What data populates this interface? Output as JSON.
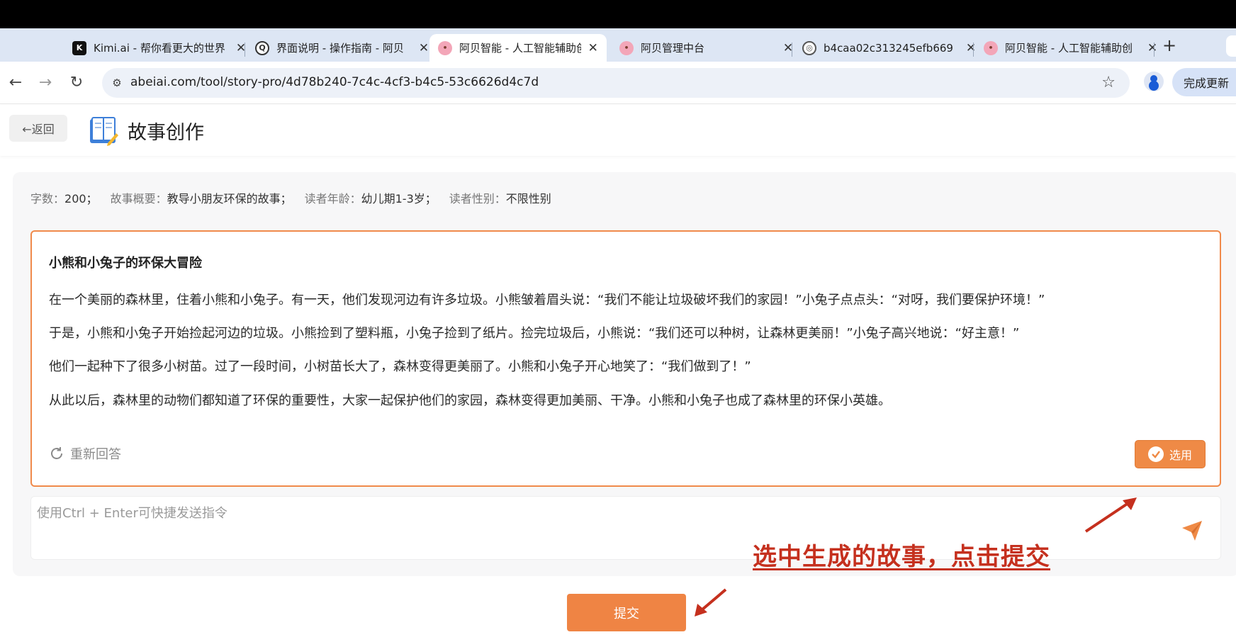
{
  "browser": {
    "tabs": [
      {
        "title": "Kimi.ai - 帮你看更大的世界",
        "icon": "kimi-logo-icon",
        "active": false
      },
      {
        "title": "界面说明 - 操作指南 - 阿贝",
        "icon": "document-icon",
        "active": false
      },
      {
        "title": "阿贝智能 - 人工智能辅助创",
        "icon": "abei-logo-icon",
        "active": true
      },
      {
        "title": "阿贝管理中台",
        "icon": "abei-logo-icon",
        "active": false
      },
      {
        "title": "b4caa02c313245efb669",
        "icon": "globe-icon",
        "active": false
      },
      {
        "title": "阿贝智能 - 人工智能辅助创",
        "icon": "abei-logo-icon",
        "active": false
      }
    ],
    "new_tab_label": "+",
    "url": "abeiai.com/tool/story-pro/4d78b240-7c4c-4cf3-b4c5-53c6626d4c7d",
    "update_label": "完成更新",
    "accent": "#dde6f4"
  },
  "header": {
    "back_label": "←返回",
    "title": "故事创作"
  },
  "meta": {
    "word_count_label": "字数：",
    "word_count_value": "200；",
    "summary_label": "故事概要：",
    "summary_value": "教导小朋友环保的故事；",
    "age_label": "读者年龄：",
    "age_value": "幼儿期1-3岁；",
    "gender_label": "读者性别：",
    "gender_value": "不限性别"
  },
  "story": {
    "title": "小熊和小兔子的环保大冒险",
    "paragraphs": [
      "在一个美丽的森林里，住着小熊和小兔子。有一天，他们发现河边有许多垃圾。小熊皱着眉头说：“我们不能让垃圾破坏我们的家园！”小兔子点点头：“对呀，我们要保护环境！”",
      "于是，小熊和小兔子开始捡起河边的垃圾。小熊捡到了塑料瓶，小兔子捡到了纸片。捡完垃圾后，小熊说：“我们还可以种树，让森林更美丽！”小兔子高兴地说：“好主意！”",
      "他们一起种下了很多小树苗。过了一段时间，小树苗长大了，森林变得更美丽了。小熊和小兔子开心地笑了：“我们做到了！”",
      "从此以后，森林里的动物们都知道了环保的重要性，大家一起保护他们的家园，森林变得更加美丽、干净。小熊和小兔子也成了森林里的环保小英雄。"
    ],
    "regenerate_label": "重新回答",
    "use_label": "选用",
    "accent": "#ef8a46"
  },
  "composer": {
    "placeholder": "使用Ctrl + Enter可快捷发送指令",
    "value": ""
  },
  "annotation": {
    "text": "选中生成的故事，点击提交",
    "color": "#c5301e"
  },
  "submit_label": "提交"
}
